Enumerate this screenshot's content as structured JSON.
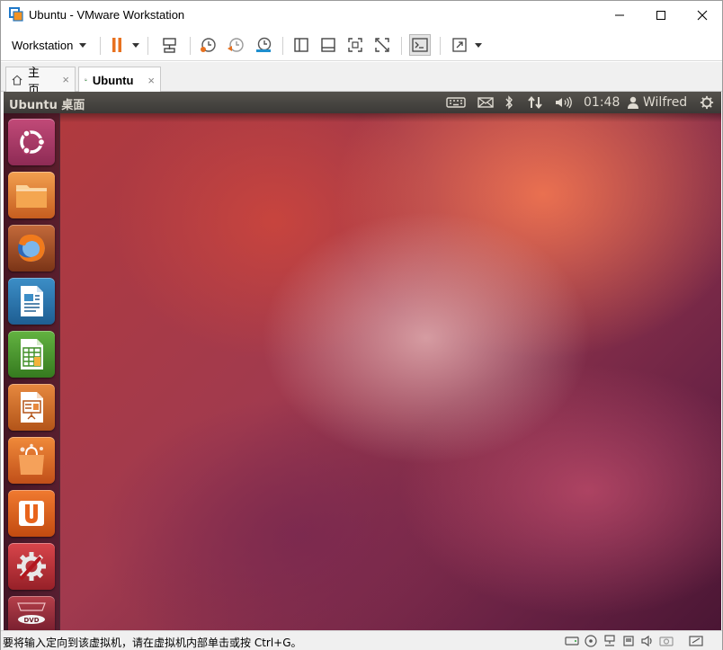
{
  "window": {
    "title": "Ubuntu - VMware Workstation"
  },
  "toolbar": {
    "workstation_label": "Workstation"
  },
  "tabs": [
    {
      "label": "主页",
      "active": false
    },
    {
      "label": "Ubuntu",
      "active": true
    }
  ],
  "tab_close_glyph": "×",
  "ubuntu": {
    "panel_title": "Ubuntu 桌面",
    "clock": "01:48",
    "user": "Wilfred",
    "launcher": [
      {
        "name": "dash-home",
        "icon": "ubuntu-logo-icon"
      },
      {
        "name": "files",
        "icon": "folder-icon"
      },
      {
        "name": "firefox",
        "icon": "firefox-icon"
      },
      {
        "name": "libreoffice-writer",
        "icon": "writer-icon"
      },
      {
        "name": "libreoffice-calc",
        "icon": "calc-icon"
      },
      {
        "name": "libreoffice-impress",
        "icon": "impress-icon"
      },
      {
        "name": "ubuntu-software-center",
        "icon": "shopping-bag-icon"
      },
      {
        "name": "ubuntu-one",
        "icon": "ubuntu-one-icon"
      },
      {
        "name": "system-settings",
        "icon": "settings-icon"
      },
      {
        "name": "dvd-workspaces",
        "icon": "dvd-icon"
      }
    ],
    "dvd_label": "DVD"
  },
  "statusbar": {
    "message": "要将输入定向到该虚拟机，请在虚拟机内部单击或按 Ctrl+G。"
  },
  "colors": {
    "pause_orange": "#e8711f",
    "ubuntu_panel": "#3c3b37"
  }
}
